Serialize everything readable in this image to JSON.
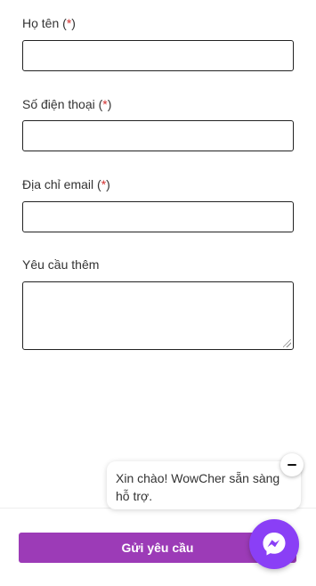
{
  "form": {
    "name": {
      "label": "Họ tên",
      "req_open": "(",
      "req_star": "*",
      "req_close": ")"
    },
    "phone": {
      "label": "Số điện thoại",
      "req_open": "(",
      "req_star": "*",
      "req_close": ")"
    },
    "email": {
      "label": "Địa chỉ email",
      "req_open": "(",
      "req_star": "*",
      "req_close": ")"
    },
    "request": {
      "label": "Yêu cầu thêm"
    },
    "submit_label": "Gửi yêu cầu"
  },
  "chat": {
    "greeting": "Xin chào! WowCher sẵn sàng hỗ trợ."
  },
  "colors": {
    "accent": "#9c3bb7",
    "messenger": "#8a3ff6",
    "required": "#d32f2f"
  }
}
